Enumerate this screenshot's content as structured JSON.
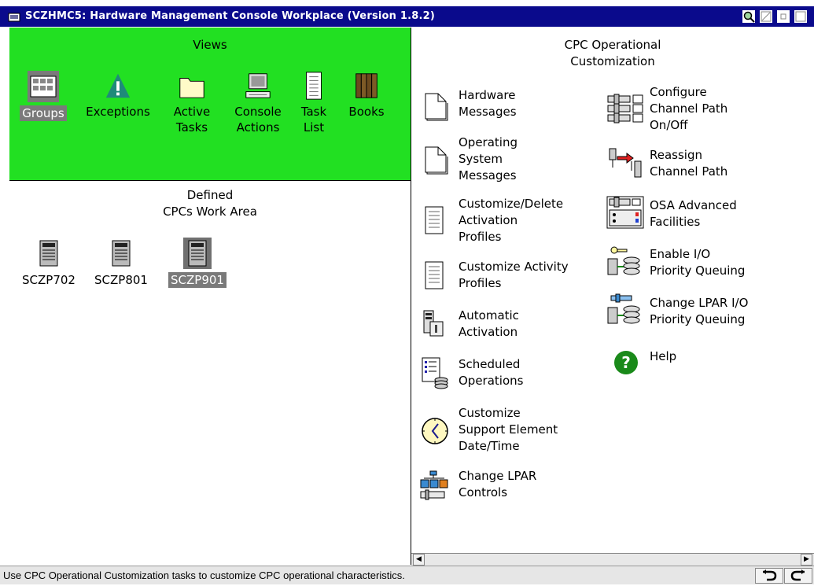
{
  "window": {
    "title": "SCZHMC5: Hardware Management Console Workplace (Version 1.8.2)"
  },
  "views": {
    "title": "Views",
    "items": [
      {
        "label": "Groups",
        "icon": "groups-icon",
        "selected": true
      },
      {
        "label": "Exceptions",
        "icon": "exceptions-icon"
      },
      {
        "label": "Active\nTasks",
        "icon": "folder-icon"
      },
      {
        "label": "Console\nActions",
        "icon": "console-icon"
      },
      {
        "label": "Task\nList",
        "icon": "task-list-icon"
      },
      {
        "label": "Books",
        "icon": "books-icon"
      }
    ]
  },
  "work_area": {
    "title_line1": "Defined",
    "title_line2": "CPCs Work Area",
    "cpcs": [
      {
        "label": "SCZP702"
      },
      {
        "label": "SCZP801"
      },
      {
        "label": "SCZP901",
        "selected": true
      }
    ]
  },
  "tasks_pane": {
    "title_line1": "CPC Operational",
    "title_line2": "Customization",
    "left_tasks": [
      {
        "lines": [
          "Hardware",
          "Messages"
        ],
        "icon": "document-icon"
      },
      {
        "lines": [
          "Operating",
          "System",
          "Messages"
        ],
        "icon": "document-icon"
      },
      {
        "lines": [
          "Customize/Delete",
          "Activation",
          "Profiles"
        ],
        "icon": "list-document-icon"
      },
      {
        "lines": [
          "Customize Activity",
          "Profiles"
        ],
        "icon": "list-document-icon"
      },
      {
        "lines": [
          "Automatic",
          "Activation"
        ],
        "icon": "activation-icon"
      },
      {
        "lines": [
          "Scheduled",
          "Operations"
        ],
        "icon": "scheduled-icon"
      },
      {
        "lines": [
          "Customize",
          "Support Element",
          "Date/Time"
        ],
        "icon": "clock-icon"
      },
      {
        "lines": [
          "Change LPAR",
          "Controls"
        ],
        "icon": "lpar-controls-icon"
      }
    ],
    "right_tasks": [
      {
        "lines": [
          "Configure",
          "Channel Path",
          "On/Off"
        ],
        "icon": "channel-path-icon"
      },
      {
        "lines": [
          "Reassign",
          "Channel Path"
        ],
        "icon": "reassign-icon"
      },
      {
        "lines": [
          "OSA Advanced",
          "Facilities"
        ],
        "icon": "osa-icon"
      },
      {
        "lines": [
          "Enable I/O",
          "Priority Queuing"
        ],
        "icon": "enable-io-icon"
      },
      {
        "lines": [
          "Change LPAR I/O",
          "Priority Queuing"
        ],
        "icon": "change-lpar-io-icon"
      },
      {
        "lines": [
          "Help"
        ],
        "icon": "help-icon"
      }
    ]
  },
  "status_bar": {
    "message": "Use CPC Operational Customization tasks to customize CPC operational characteristics."
  },
  "colors": {
    "title_bar": "#0a0a8c",
    "views_background": "#22e022",
    "selection": "#7a7a7a"
  }
}
